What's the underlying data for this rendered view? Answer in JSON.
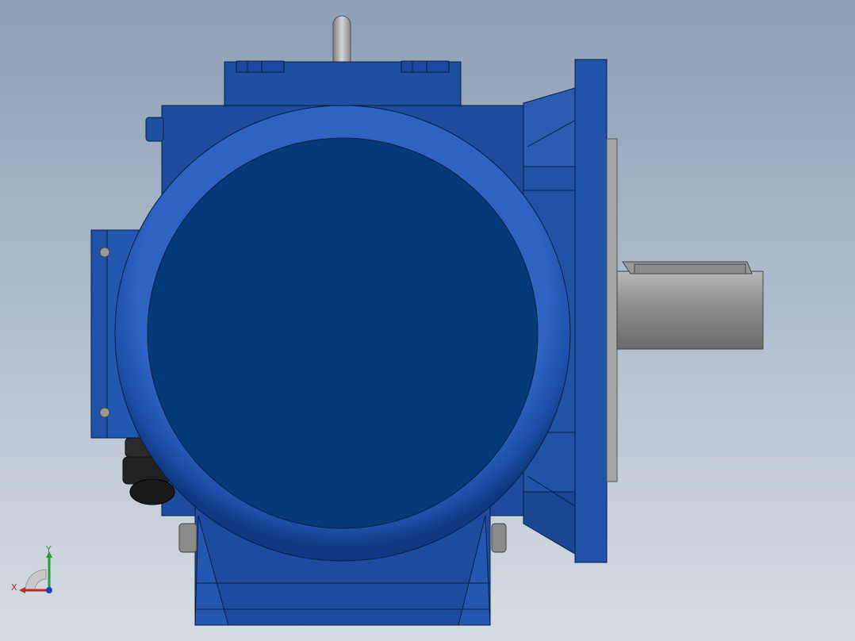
{
  "viewport": {
    "colors": {
      "background_top": "#8c9fb7",
      "background_bottom": "#d6dce3",
      "housing_blue": "#1f4fa0",
      "housing_dark": "#0d3575",
      "motor_cover": "#043a7a",
      "shaft_grey": "#8e8e8e",
      "flange_grey": "#a7a7a7",
      "cable_gland_black": "#222222"
    }
  },
  "triad": {
    "x_label": "X",
    "y_label": "Y",
    "x_color": "#c0282a",
    "y_color": "#2a9a3a",
    "z_color": "#1f3fbf"
  }
}
